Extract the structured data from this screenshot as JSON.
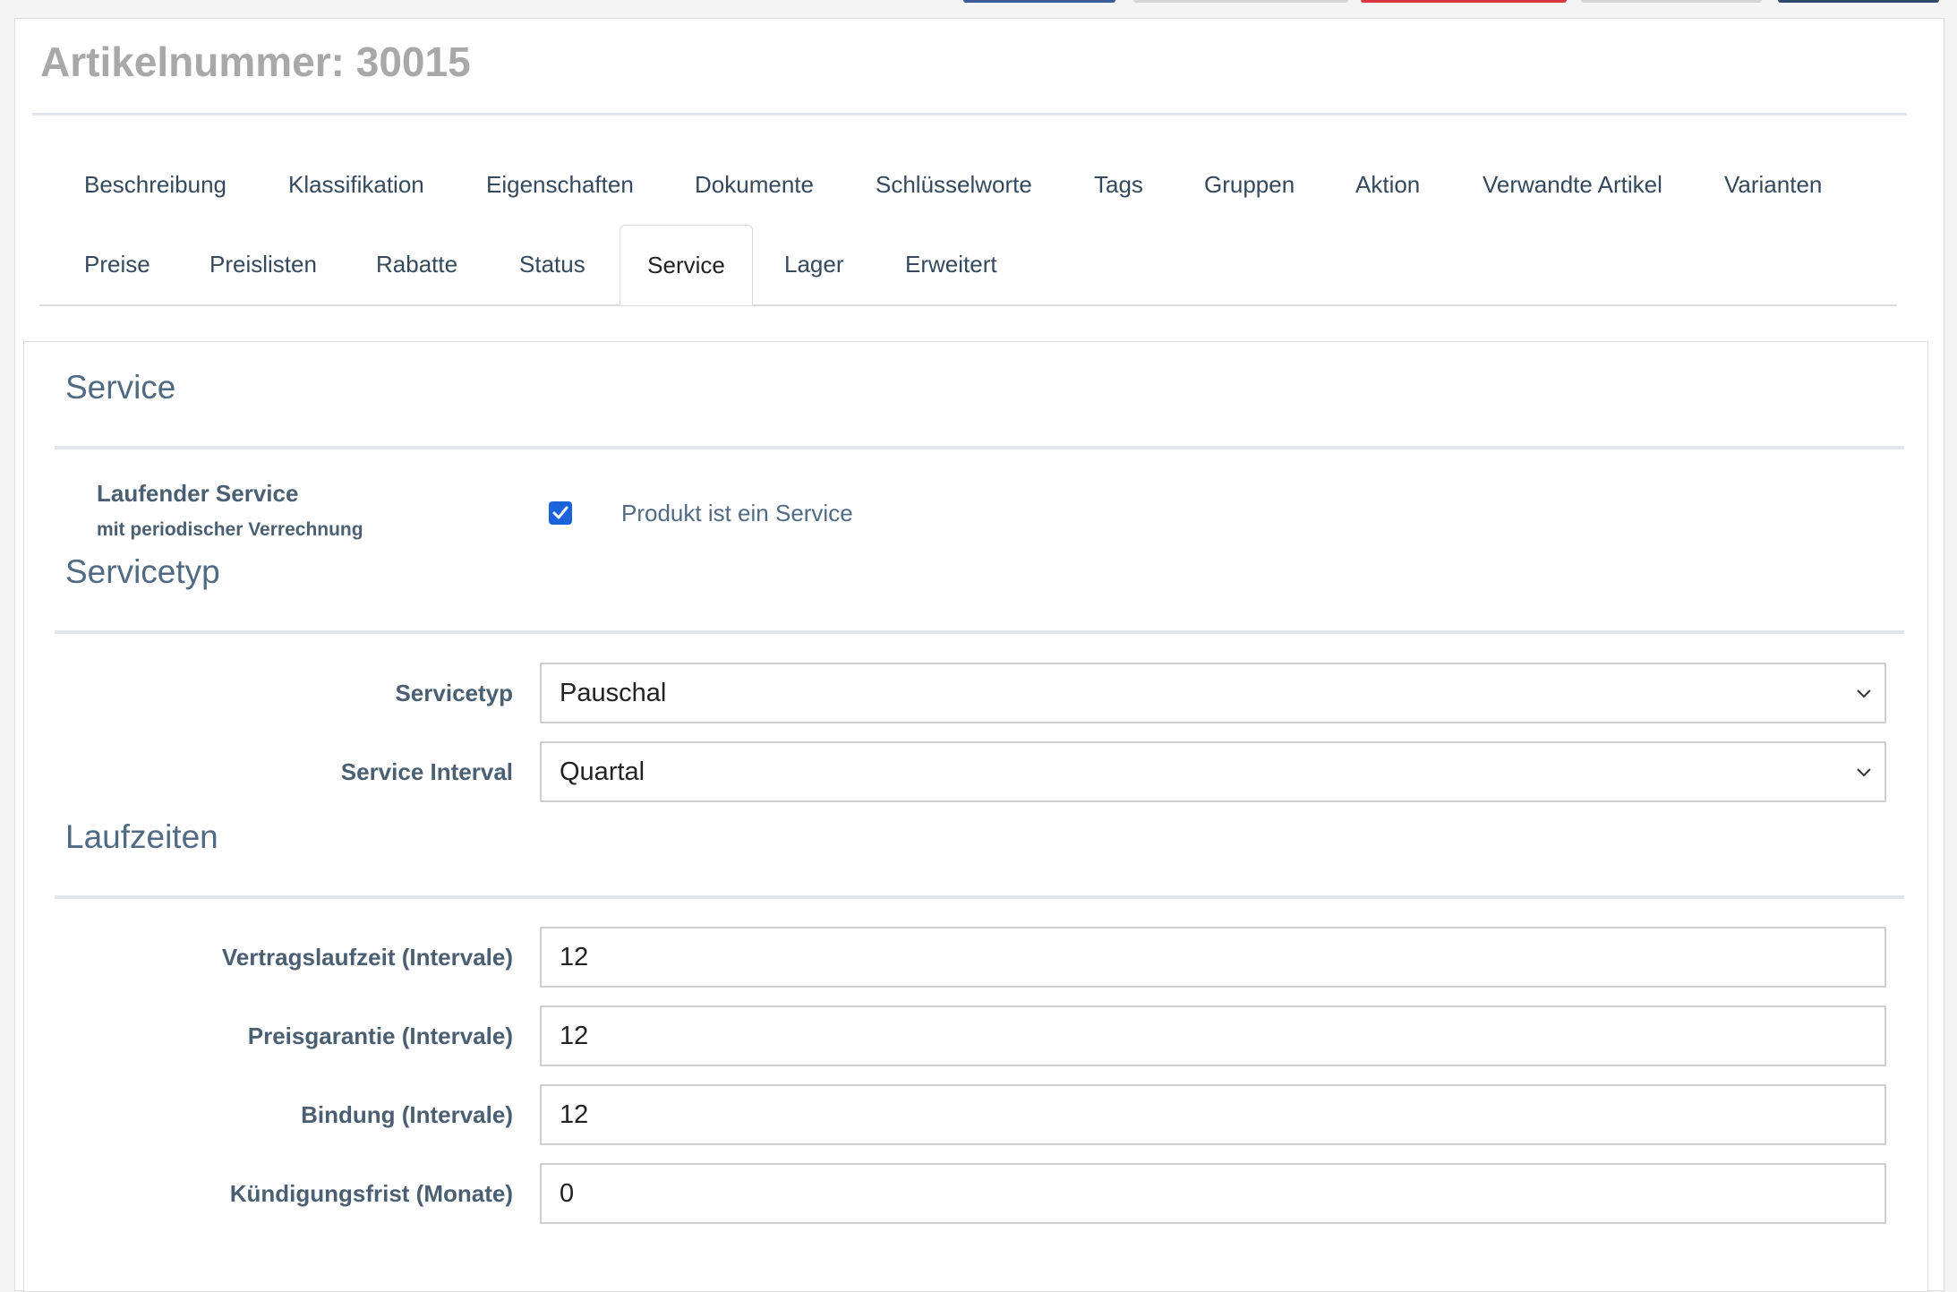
{
  "page_title": "Artikelnummer: 30015",
  "top_buttons": [
    {
      "color": "#3b5a99"
    },
    {
      "color": "#d6d6d6"
    },
    {
      "color": "#d9363e"
    },
    {
      "color": "#d6d6d6"
    },
    {
      "color": "#2f4a6b"
    }
  ],
  "tabs": {
    "row1": [
      "Beschreibung",
      "Klassifikation",
      "Eigenschaften",
      "Dokumente",
      "Schlüsselworte",
      "Tags",
      "Gruppen",
      "Aktion",
      "Verwandte Artikel",
      "Varianten"
    ],
    "row2": [
      "Preise",
      "Preislisten",
      "Rabatte",
      "Status",
      "Service",
      "Lager",
      "Erweitert"
    ],
    "active": "Service"
  },
  "service": {
    "heading": "Service",
    "running_label": "Laufender Service",
    "running_sublabel": "mit periodischer Verrechnung",
    "checkbox_checked": true,
    "checkbox_label": "Produkt ist ein Service"
  },
  "servicetyp": {
    "heading": "Servicetyp",
    "type_label": "Servicetyp",
    "type_value": "Pauschal",
    "interval_label": "Service Interval",
    "interval_value": "Quartal"
  },
  "laufzeiten": {
    "heading": "Laufzeiten",
    "fields": [
      {
        "label": "Vertragslaufzeit (Intervale)",
        "value": "12"
      },
      {
        "label": "Preisgarantie (Intervale)",
        "value": "12"
      },
      {
        "label": "Bindung (Intervale)",
        "value": "12"
      },
      {
        "label": "Kündigungsfrist (Monate)",
        "value": "0"
      }
    ]
  }
}
